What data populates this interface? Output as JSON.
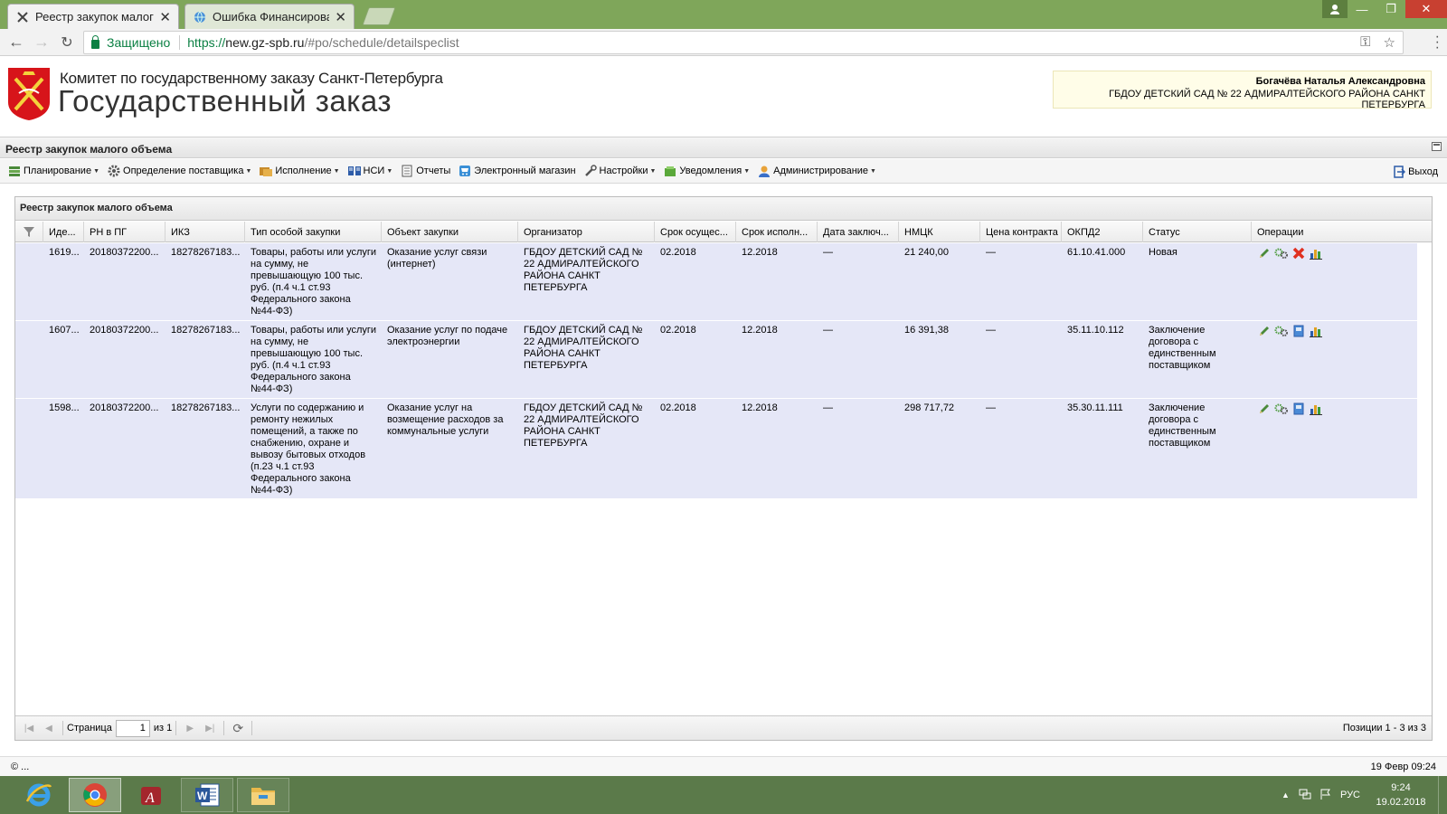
{
  "browser": {
    "tabs": [
      {
        "title": "Реестр закупок малого",
        "active": true
      },
      {
        "title": "Ошибка Финансирован",
        "active": false
      }
    ],
    "address": {
      "secure_label": "Защищено",
      "url_scheme": "https://",
      "url_host": "new.gz-spb.ru",
      "url_path": "/#po/schedule/detailspeclist"
    }
  },
  "header": {
    "org_name": "Комитет по государственному заказу Санкт-Петербурга",
    "site_name": "Государственный заказ",
    "user_name": "Богачёва Наталья Александровна",
    "user_org": "ГБДОУ ДЕТСКИЙ САД № 22 АДМИРАЛТЕЙСКОГО РАЙОНА САНКТ ПЕТЕРБУРГА"
  },
  "panel": {
    "title": "Реестр закупок малого объема"
  },
  "menu": {
    "items": [
      {
        "label": "Планирование",
        "icon": "planning-icon",
        "dropdown": true
      },
      {
        "label": "Определение поставщика",
        "icon": "gear-icon",
        "dropdown": true
      },
      {
        "label": "Исполнение",
        "icon": "execution-icon",
        "dropdown": true
      },
      {
        "label": "НСИ",
        "icon": "book-icon",
        "dropdown": true
      },
      {
        "label": "Отчеты",
        "icon": "report-icon",
        "dropdown": false
      },
      {
        "label": "Электронный магазин",
        "icon": "cart-icon",
        "dropdown": false
      },
      {
        "label": "Настройки",
        "icon": "wrench-icon",
        "dropdown": true
      },
      {
        "label": "Уведомления",
        "icon": "notification-icon",
        "dropdown": true
      },
      {
        "label": "Администрирование",
        "icon": "user-icon",
        "dropdown": true
      }
    ],
    "logout": "Выход"
  },
  "grid": {
    "title": "Реестр закупок малого объема",
    "columns": [
      "",
      "Иде...",
      "РН в ПГ",
      "ИКЗ",
      "Тип особой закупки",
      "Объект закупки",
      "Организатор",
      "Срок осущес...",
      "Срок исполн...",
      "Дата заключ...",
      "НМЦК",
      "Цена контракта",
      "ОКПД2",
      "Статус",
      "Операции"
    ],
    "rows": [
      {
        "id": "1619...",
        "rn": "20180372200...",
        "ikz": "18278267183...",
        "type": "Товары, работы или услуги на сумму, не превышающую 100 тыс. руб. (п.4 ч.1 ст.93 Федерального закона №44-ФЗ)",
        "object": "Оказание услуг связи (интернет)",
        "organizer": "ГБДОУ ДЕТСКИЙ САД № 22 АДМИРАЛТЕЙСКОГО РАЙОНА САНКТ ПЕТЕРБУРГА",
        "period_start": "02.2018",
        "period_exec": "12.2018",
        "date_signed": "—",
        "nmck": "21 240,00",
        "price": "—",
        "okpd2": "61.10.41.000",
        "status": "Новая",
        "ops": [
          "edit-icon",
          "settings-icon",
          "delete-icon",
          "chart-icon"
        ]
      },
      {
        "id": "1607...",
        "rn": "20180372200...",
        "ikz": "18278267183...",
        "type": "Товары, работы или услуги на сумму, не превышающую 100 тыс. руб. (п.4 ч.1 ст.93 Федерального закона №44-ФЗ)",
        "object": "Оказание услуг по подаче электроэнергии",
        "organizer": "ГБДОУ ДЕТСКИЙ САД № 22 АДМИРАЛТЕЙСКОГО РАЙОНА САНКТ ПЕТЕРБУРГА",
        "period_start": "02.2018",
        "period_exec": "12.2018",
        "date_signed": "—",
        "nmck": "16 391,38",
        "price": "—",
        "okpd2": "35.11.10.112",
        "status": "Заключение договора с единственным поставщиком",
        "ops": [
          "edit-icon",
          "settings-icon",
          "document-icon",
          "chart-icon"
        ]
      },
      {
        "id": "1598...",
        "rn": "20180372200...",
        "ikz": "18278267183...",
        "type": "Услуги по содержанию и ремонту нежилых помещений, а также по снабжению, охране и вывозу бытовых отходов (п.23 ч.1 ст.93 Федерального закона №44-ФЗ)",
        "object": "Оказание услуг на возмещение расходов за коммунальные услуги",
        "organizer": "ГБДОУ ДЕТСКИЙ САД № 22 АДМИРАЛТЕЙСКОГО РАЙОНА САНКТ ПЕТЕРБУРГА",
        "period_start": "02.2018",
        "period_exec": "12.2018",
        "date_signed": "—",
        "nmck": "298 717,72",
        "price": "—",
        "okpd2": "35.30.11.111",
        "status": "Заключение договора с единственным поставщиком",
        "ops": [
          "edit-icon",
          "settings-icon",
          "document-icon",
          "chart-icon"
        ]
      }
    ],
    "pager": {
      "page_label": "Страница",
      "page_value": "1",
      "of_label": "из 1",
      "positions": "Позиции 1 - 3 из 3"
    }
  },
  "footer": {
    "copyright": "© ...",
    "datetime": "19 Февр 09:24"
  },
  "taskbar": {
    "language": "РУС",
    "time": "9:24",
    "date": "19.02.2018"
  },
  "colors": {
    "row_bg": "#e5e7f7",
    "tabstrip": "#7fa65a",
    "taskbar": "#5b7a4a",
    "secure_green": "#0b8043"
  }
}
